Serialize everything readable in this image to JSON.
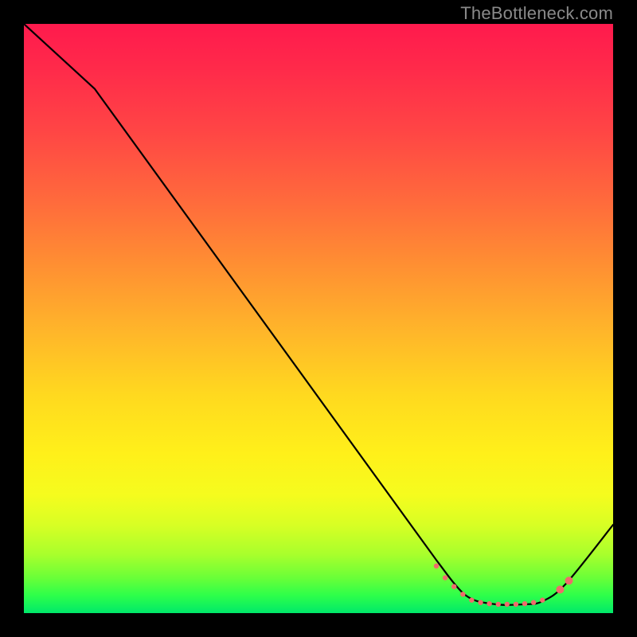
{
  "watermark": "TheBottleneck.com",
  "chart_data": {
    "type": "line",
    "title": "",
    "xlabel": "",
    "ylabel": "",
    "xlim": [
      0,
      100
    ],
    "ylim": [
      0,
      100
    ],
    "grid": false,
    "legend": false,
    "series": [
      {
        "name": "curve",
        "color": "#000000",
        "x": [
          0,
          12,
          70,
          75,
          80,
          85,
          88,
          92,
          100
        ],
        "y": [
          100,
          89,
          9,
          3,
          1.5,
          1.5,
          2,
          5,
          15
        ]
      }
    ],
    "markers": {
      "name": "highlight-dots",
      "color": "#ef6b6b",
      "radius_small": 3.2,
      "radius_large": 5.0,
      "points": [
        {
          "x": 70.0,
          "y": 8.0,
          "r": "small"
        },
        {
          "x": 71.5,
          "y": 6.0,
          "r": "small"
        },
        {
          "x": 73.0,
          "y": 4.5,
          "r": "small"
        },
        {
          "x": 74.5,
          "y": 3.2,
          "r": "small"
        },
        {
          "x": 76.0,
          "y": 2.2,
          "r": "small"
        },
        {
          "x": 77.5,
          "y": 1.8,
          "r": "small"
        },
        {
          "x": 79.0,
          "y": 1.6,
          "r": "small"
        },
        {
          "x": 80.5,
          "y": 1.5,
          "r": "small"
        },
        {
          "x": 82.0,
          "y": 1.5,
          "r": "small"
        },
        {
          "x": 83.5,
          "y": 1.5,
          "r": "small"
        },
        {
          "x": 85.0,
          "y": 1.6,
          "r": "small"
        },
        {
          "x": 86.5,
          "y": 1.8,
          "r": "small"
        },
        {
          "x": 88.0,
          "y": 2.2,
          "r": "small"
        },
        {
          "x": 91.0,
          "y": 4.0,
          "r": "large"
        },
        {
          "x": 92.5,
          "y": 5.5,
          "r": "large"
        }
      ]
    }
  }
}
